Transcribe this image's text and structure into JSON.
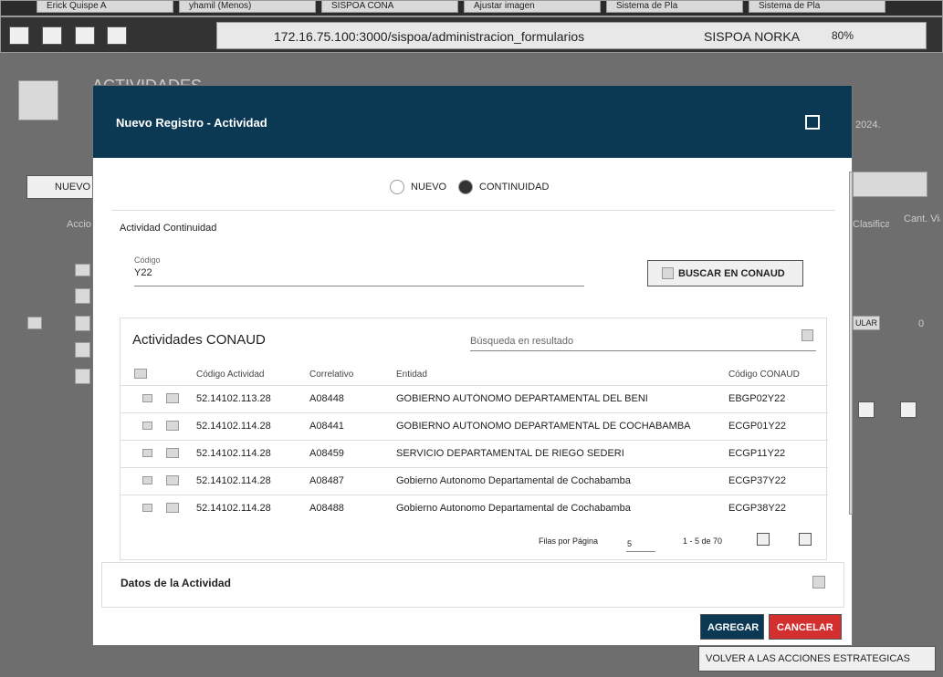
{
  "browser": {
    "tabs": [
      "Erick Quispe A",
      "yhamil (Menos)",
      "SISPOA CONA",
      "Ajustar imagen",
      "Sistema de Pla",
      "Sistema de Pla"
    ],
    "url": "172.16.75.100:3000/sispoa/administracion_formularios",
    "site_badge": "SISPOA NORKA",
    "zoom": "80%"
  },
  "page": {
    "title": "ACTIVIDADES",
    "subtitle_tail": "2024.",
    "new_button": "NUEVO",
    "col_actions": "Acciones",
    "col_clasificacion": "Clasificación actividad",
    "col_viaticos": "Cant. Viáticos",
    "row_badge": "ULAR",
    "row_count": "0",
    "back_button": "VOLVER A LAS ACCIONES ESTRATEGICAS"
  },
  "modal": {
    "title": "Nuevo Registro - Actividad",
    "radio_nuevo": "NUEVO",
    "radio_continuidad": "CONTINUIDAD",
    "section_label": "Actividad Continuidad",
    "codigo_label": "Código",
    "codigo_value": "Y22",
    "buscar_button": "BUSCAR EN CONAUD",
    "table_title": "Actividades CONAUD",
    "search_placeholder": "Búsqueda en resultado",
    "columns": [
      "Código Actividad",
      "Correlativo",
      "Entidad",
      "Código CONAUD"
    ],
    "rows": [
      {
        "codigo": "52.14102.113.28",
        "correlativo": "A08448",
        "entidad": "GOBIERNO AUTÓNOMO DEPARTAMENTAL DEL BENI",
        "conaud": "EBGP02Y22"
      },
      {
        "codigo": "52.14102.114.28",
        "correlativo": "A08441",
        "entidad": "GOBIERNO AUTONOMO DEPARTAMENTAL DE COCHABAMBA",
        "conaud": "ECGP01Y22"
      },
      {
        "codigo": "52.14102.114.28",
        "correlativo": "A08459",
        "entidad": "SERVICIO DEPARTAMENTAL DE RIEGO SEDERI",
        "conaud": "ECGP11Y22"
      },
      {
        "codigo": "52.14102.114.28",
        "correlativo": "A08487",
        "entidad": "Gobierno Autonomo Departamental de Cochabamba",
        "conaud": "ECGP37Y22"
      },
      {
        "codigo": "52.14102.114.28",
        "correlativo": "A08488",
        "entidad": "Gobierno Autonomo Departamental de Cochabamba",
        "conaud": "ECGP38Y22"
      }
    ],
    "rows_per_page_label": "Filas por Página",
    "rows_per_page": "5",
    "range": "1 - 5 de 70",
    "datos_section": "Datos de la Actividad",
    "agregar": "AGREGAR",
    "cancelar": "CANCELAR"
  }
}
